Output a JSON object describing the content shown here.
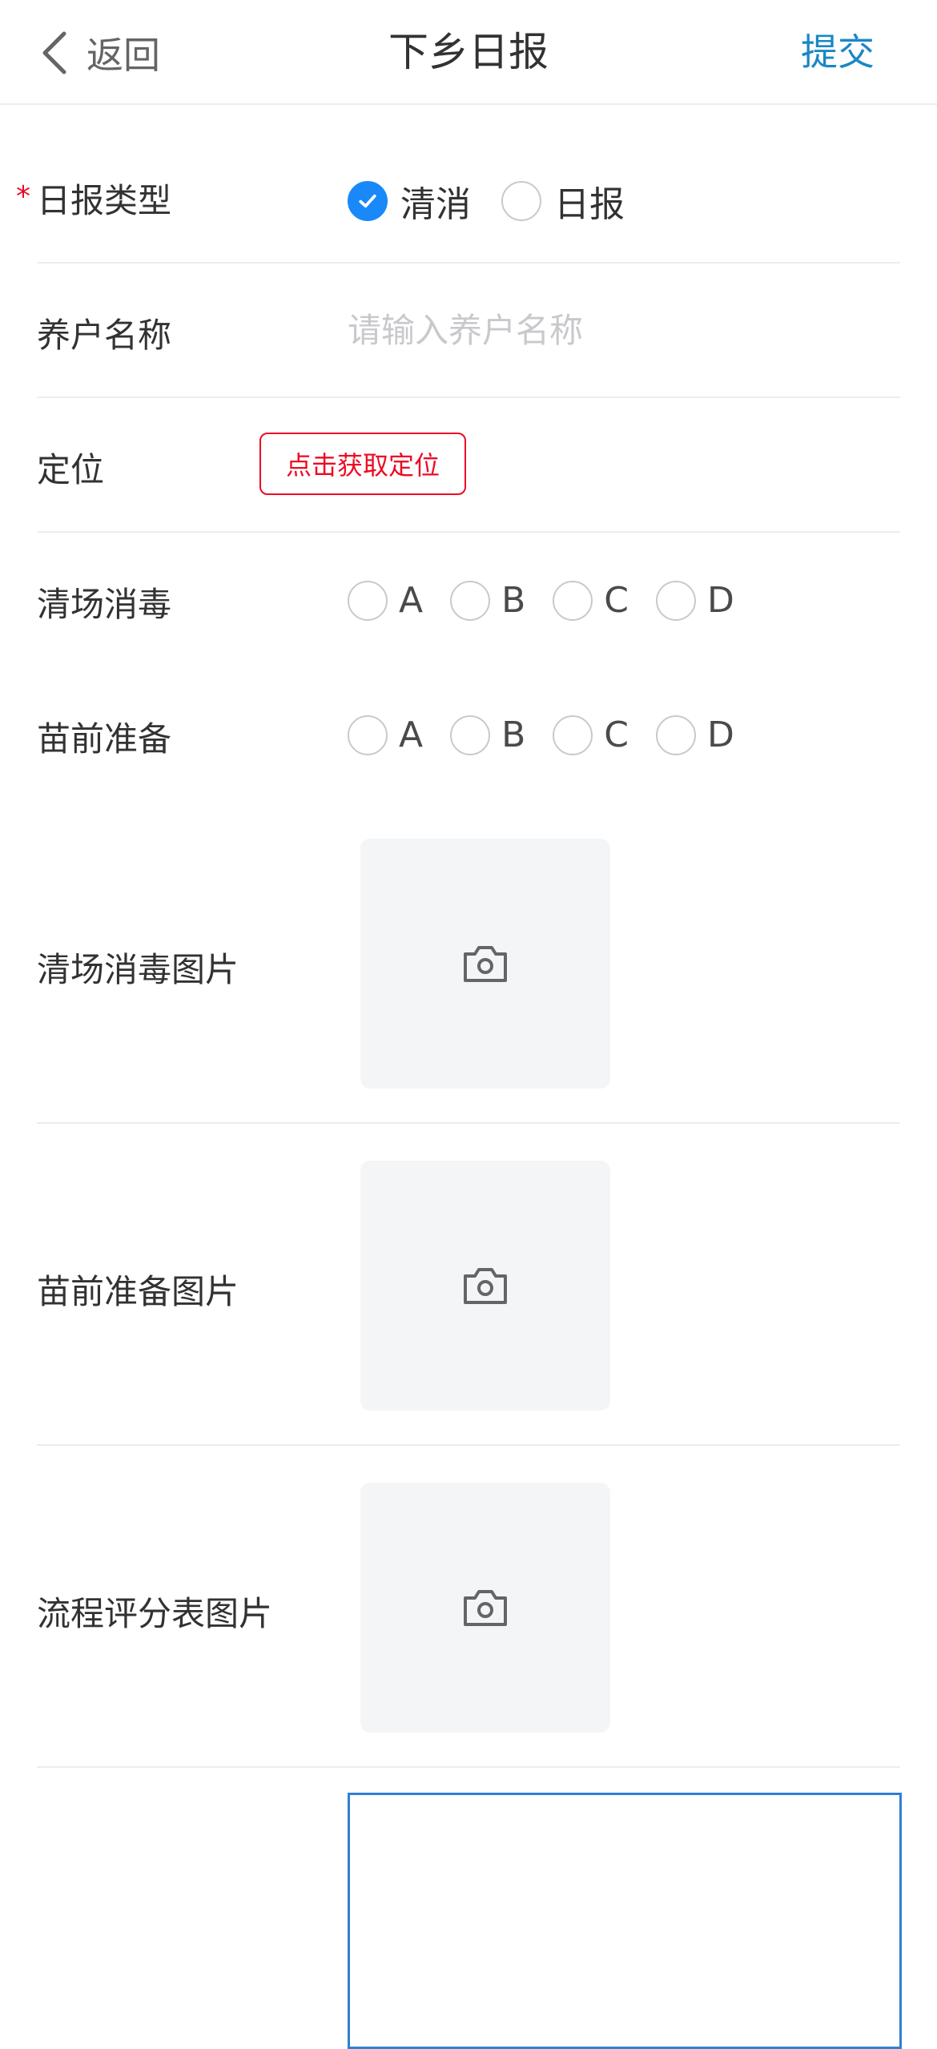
{
  "header": {
    "back_label": "返回",
    "title": "下乡日报",
    "submit_label": "提交"
  },
  "form": {
    "report_type": {
      "label": "日报类型",
      "required_mark": "*",
      "options": [
        "清消",
        "日报"
      ],
      "selected": "清消"
    },
    "farmer_name": {
      "label": "养户名称",
      "placeholder": "请输入养户名称",
      "value": ""
    },
    "location": {
      "label": "定位",
      "button_label": "点击获取定位"
    },
    "disinfection": {
      "label": "清场消毒",
      "options": [
        "A",
        "B",
        "C",
        "D"
      ]
    },
    "pre_seedling": {
      "label": "苗前准备",
      "options": [
        "A",
        "B",
        "C",
        "D"
      ]
    },
    "disinfection_photo": {
      "label": "清场消毒图片",
      "icon": "camera-icon"
    },
    "pre_seedling_photo": {
      "label": "苗前准备图片",
      "icon": "camera-icon"
    },
    "scoring_sheet_photo": {
      "label": "流程评分表图片",
      "icon": "camera-icon"
    },
    "remarks": {
      "value": ""
    }
  },
  "colors": {
    "accent": "#1989fa",
    "danger": "#ee0a24",
    "nav_action": "#1a87c4"
  }
}
